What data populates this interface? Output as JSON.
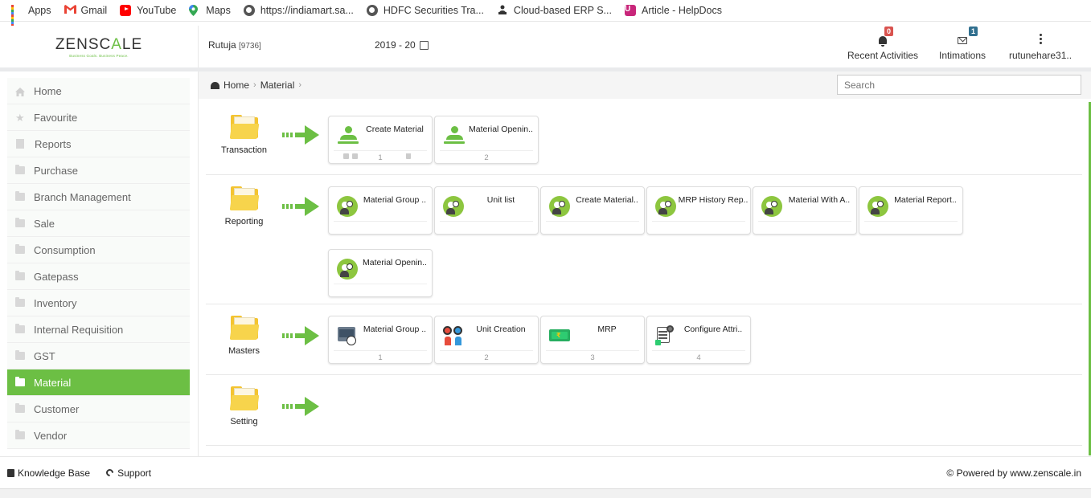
{
  "bookmarks": [
    {
      "id": "apps",
      "label": "Apps",
      "icon": "apps-grid-icon"
    },
    {
      "id": "gmail",
      "label": "Gmail",
      "icon": "gmail-icon"
    },
    {
      "id": "youtube",
      "label": "YouTube",
      "icon": "youtube-icon"
    },
    {
      "id": "maps",
      "label": "Maps",
      "icon": "maps-icon"
    },
    {
      "id": "indiamart",
      "label": "https://indiamart.sa...",
      "icon": "globe-icon"
    },
    {
      "id": "hdfc",
      "label": "HDFC Securities Tra...",
      "icon": "globe-icon"
    },
    {
      "id": "erp",
      "label": "Cloud-based ERP S...",
      "icon": "erp-icon"
    },
    {
      "id": "helpdocs",
      "label": "Article - HelpDocs",
      "icon": "helpdocs-icon"
    }
  ],
  "header": {
    "logo": {
      "part1": "ZENSC",
      "part2": "A",
      "part3": "LE",
      "tagline": "Business Goals. Business Peace."
    },
    "user_name": "Rutuja",
    "user_id": "[9736]",
    "financial_year": "2019 - 20",
    "recent_activities": {
      "label": "Recent Activities",
      "count": "0",
      "badge_color": "#d9534f"
    },
    "intimations": {
      "label": "Intimations",
      "count": "1",
      "badge_color": "#31708f"
    },
    "account": {
      "label": "rutunehare31.."
    }
  },
  "sidebar": {
    "accent": "#6cbf44",
    "items": [
      {
        "label": "Home",
        "icon": "home-icon"
      },
      {
        "label": "Favourite",
        "icon": "star-icon"
      },
      {
        "label": "Reports",
        "icon": "document-icon"
      },
      {
        "label": "Purchase",
        "icon": "folder-icon"
      },
      {
        "label": "Branch Management",
        "icon": "folder-icon"
      },
      {
        "label": "Sale",
        "icon": "folder-icon"
      },
      {
        "label": "Consumption",
        "icon": "folder-icon"
      },
      {
        "label": "Gatepass",
        "icon": "folder-icon"
      },
      {
        "label": "Inventory",
        "icon": "folder-icon"
      },
      {
        "label": "Internal Requisition",
        "icon": "folder-icon"
      },
      {
        "label": "GST",
        "icon": "folder-icon"
      },
      {
        "label": "Material",
        "icon": "folder-icon",
        "active": true
      },
      {
        "label": "Customer",
        "icon": "folder-icon"
      },
      {
        "label": "Vendor",
        "icon": "folder-icon"
      }
    ]
  },
  "breadcrumb": {
    "home": "Home",
    "current": "Material",
    "sep": "›"
  },
  "search": {
    "placeholder": "Search"
  },
  "sections": {
    "transaction": {
      "label": "Transaction",
      "cards": [
        {
          "title": "Create Material",
          "num": "1",
          "icon": "user-add-icon"
        },
        {
          "title": "Material Openin..",
          "num": "2",
          "icon": "user-add-icon"
        }
      ]
    },
    "reporting": {
      "label": "Reporting",
      "cards": [
        {
          "title": "Material Group ..",
          "icon": "report-person-icon"
        },
        {
          "title": "Unit list",
          "icon": "report-person-icon"
        },
        {
          "title": "Create Material..",
          "icon": "report-person-icon"
        },
        {
          "title": "MRP History Rep..",
          "icon": "report-person-icon"
        },
        {
          "title": "Material With A..",
          "icon": "report-person-icon"
        },
        {
          "title": "Material Report..",
          "icon": "report-person-icon"
        },
        {
          "title": "Material Openin..",
          "icon": "report-person-icon"
        }
      ]
    },
    "masters": {
      "label": "Masters",
      "cards": [
        {
          "title": "Material Group ..",
          "num": "1",
          "icon": "material-group-icon"
        },
        {
          "title": "Unit Creation",
          "num": "2",
          "icon": "unit-creation-icon"
        },
        {
          "title": "MRP",
          "num": "3",
          "icon": "currency-note-icon"
        },
        {
          "title": "Configure Attri..",
          "num": "4",
          "icon": "configure-document-icon"
        }
      ]
    },
    "setting": {
      "label": "Setting",
      "cards": []
    }
  },
  "footer": {
    "knowledge_base": "Knowledge Base",
    "support": "Support",
    "powered_by": "© Powered by www.zenscale.in"
  }
}
